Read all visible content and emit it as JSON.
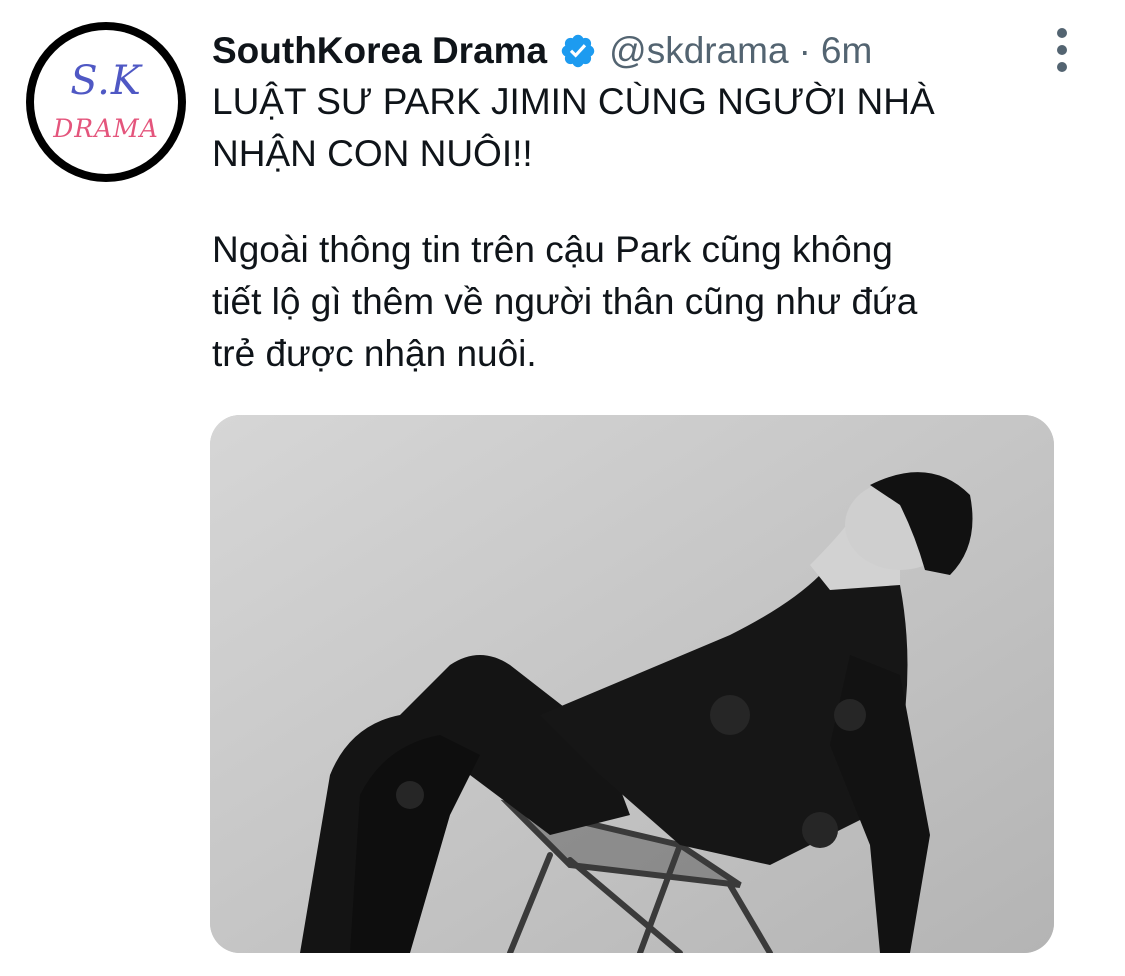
{
  "tweet": {
    "display_name": "SouthKorea Drama",
    "verified_icon": "verified-badge-icon",
    "handle": "@skdrama",
    "separator": "·",
    "time": "6m",
    "more_icon": "more-vertical-icon",
    "avatar": {
      "logo_line1": "S.K",
      "logo_line2": "DRAMA"
    },
    "text_lines": [
      "LUẬT SƯ PARK JIMIN CÙNG NGƯỜI NHÀ",
      "NHẬN CON NUÔI!!",
      "Ngoài thông tin trên cậu Park cũng không",
      "tiết lộ gì thêm về người thân cũng như đứa",
      "trẻ được nhận nuôi."
    ],
    "media": {
      "description_icon": "photo-image"
    }
  },
  "colors": {
    "text_primary": "#0f1419",
    "text_secondary": "#536471",
    "verified_blue": "#1d9bf0",
    "logo_blue": "#4f58c4",
    "logo_pink": "#e4557c"
  }
}
